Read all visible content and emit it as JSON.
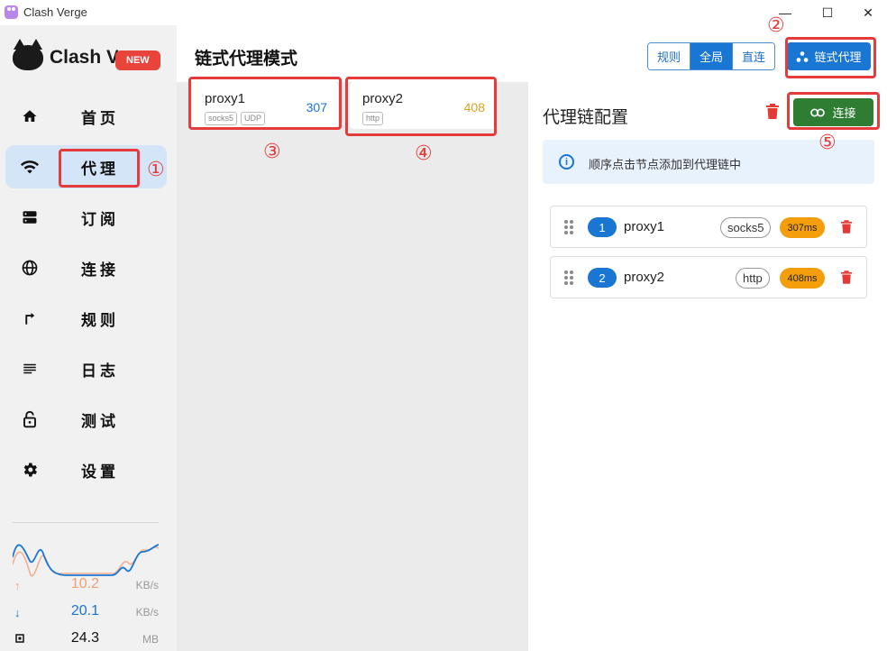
{
  "window": {
    "title": "Clash Verge",
    "minimize": "—",
    "maximize": "☐",
    "close": "✕"
  },
  "sidebar": {
    "logo_text": "Clash Verge",
    "new_badge": "NEW",
    "items": [
      {
        "label": "首页",
        "icon": "home-icon"
      },
      {
        "label": "代理",
        "icon": "wifi-icon",
        "active": true
      },
      {
        "label": "订阅",
        "icon": "storage-icon"
      },
      {
        "label": "连接",
        "icon": "globe-icon"
      },
      {
        "label": "规则",
        "icon": "fork-arrow-icon"
      },
      {
        "label": "日志",
        "icon": "lines-icon"
      },
      {
        "label": "测试",
        "icon": "lock-icon"
      },
      {
        "label": "设置",
        "icon": "gear-icon"
      }
    ],
    "stats": {
      "upload": {
        "value": "10.2",
        "unit": "KB/s",
        "color": "#f0a070"
      },
      "download": {
        "value": "20.1",
        "unit": "KB/s",
        "color": "#1976d2"
      },
      "memory": {
        "value": "24.3",
        "unit": "MB"
      }
    }
  },
  "annotations": {
    "n1": "①",
    "n2": "②",
    "n3": "③",
    "n4": "④",
    "n5": "⑤"
  },
  "header": {
    "title": "链式代理模式",
    "modes": [
      "规则",
      "全局",
      "直连"
    ],
    "active_mode": "全局",
    "chain_button": "链式代理"
  },
  "proxies": [
    {
      "name": "proxy1",
      "tags": [
        "socks5",
        "UDP"
      ],
      "delay": "307",
      "delay_color": "#1976d2"
    },
    {
      "name": "proxy2",
      "tags": [
        "http"
      ],
      "delay": "408",
      "delay_color": "#e0a020"
    }
  ],
  "chain": {
    "title": "代理链配置",
    "connect_label": "连接",
    "info": "顺序点击节点添加到代理链中",
    "items": [
      {
        "index": "1",
        "name": "proxy1",
        "type": "socks5",
        "delay": "307ms"
      },
      {
        "index": "2",
        "name": "proxy2",
        "type": "http",
        "delay": "408ms"
      }
    ]
  },
  "colors": {
    "accent": "#1976d2",
    "highlight": "#e53b3b",
    "connect": "#2e7d32",
    "delay_chip": "#f59e0b"
  }
}
